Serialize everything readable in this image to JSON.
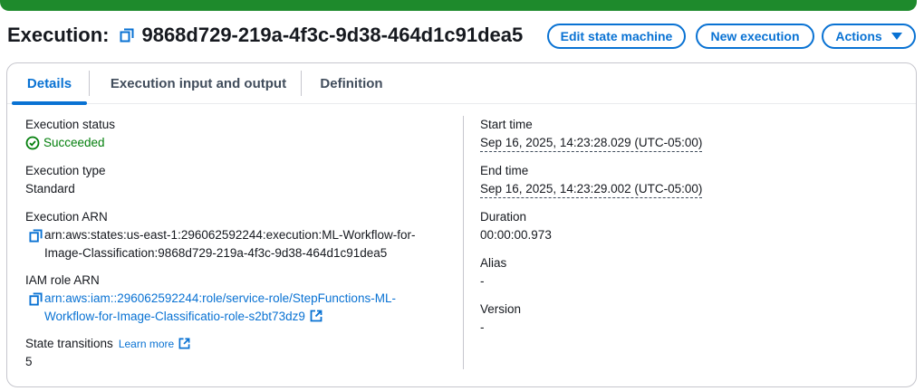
{
  "header": {
    "title_prefix": "Execution:",
    "execution_id": "9868d729-219a-4f3c-9d38-464d1c91dea5",
    "buttons": {
      "edit": "Edit state machine",
      "new": "New execution",
      "actions": "Actions"
    }
  },
  "tabs": [
    "Details",
    "Execution input and output",
    "Definition"
  ],
  "details": {
    "status_label": "Execution status",
    "status_value": "Succeeded",
    "type_label": "Execution type",
    "type_value": "Standard",
    "arn_label": "Execution ARN",
    "arn_value": "arn:aws:states:us-east-1:296062592244:execution:ML-Workflow-for-\nImage-Classification:9868d729-219a-4f3c-9d38-464d1c91dea5",
    "role_label": "IAM role ARN",
    "role_value": "arn:aws:iam::296062592244:role/service-role/StepFunctions-ML-\nWorkflow-for-Image-Classificatio-role-s2bt73dz9",
    "transitions_label": "State transitions",
    "learn_more": "Learn more",
    "transitions_value": "5",
    "start_label": "Start time",
    "start_value": "Sep 16, 2025, 14:23:28.029 (UTC-05:00)",
    "end_label": "End time",
    "end_value": "Sep 16, 2025, 14:23:29.002 (UTC-05:00)",
    "duration_label": "Duration",
    "duration_value": "00:00:00.973",
    "alias_label": "Alias",
    "alias_value": "-",
    "version_label": "Version",
    "version_value": "-"
  },
  "colors": {
    "accent": "#0972d3",
    "success": "#037f0c",
    "banner": "#1e8a2c"
  }
}
